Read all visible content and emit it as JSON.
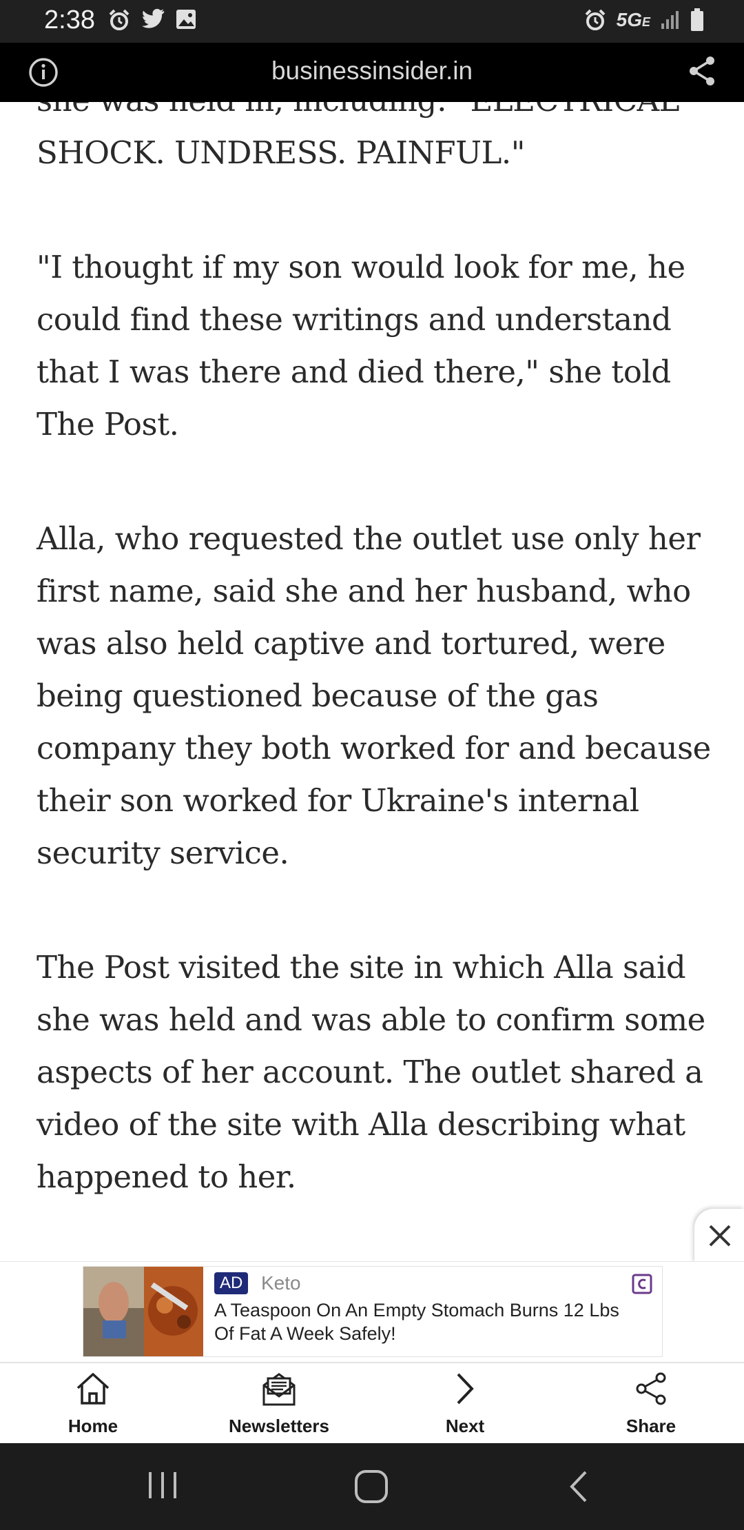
{
  "status_bar": {
    "time": "2:38",
    "network": "5G",
    "network_sub": "E",
    "left_icons": [
      "alarm-icon",
      "twitter-icon",
      "image-icon"
    ],
    "right_icons": [
      "alarm-icon",
      "signal-icon",
      "battery-icon"
    ]
  },
  "url_bar": {
    "domain": "businessinsider.in"
  },
  "article": {
    "paragraphs": [
      "she was held in, including: \"ELECTRICAL SHOCK. UNDRESS. PAINFUL.\"",
      "\"I thought if my son would look for me, he could find these writings and understand that I was there and died there,\" she told The Post.",
      "Alla, who requested the outlet use only her first name, said she and her husband, who was also held captive and tortured, were being questioned because of the gas company they both worked for and because their son worked for Ukraine's internal security service.",
      "The Post visited the site in which Alla said she was held and was able to confirm some aspects of her account. The outlet shared a video of the site with Alla describing what happened to her."
    ]
  },
  "ad": {
    "badge": "AD",
    "brand": "Keto",
    "headline": "A Teaspoon On An Empty Stomach Burns 12 Lbs Of Fat A Week Safely!"
  },
  "bottom_nav": {
    "items": [
      {
        "label": "Home",
        "icon": "home-icon"
      },
      {
        "label": "Newsletters",
        "icon": "newsletter-icon"
      },
      {
        "label": "Next",
        "icon": "chevron-right-icon"
      },
      {
        "label": "Share",
        "icon": "share-icon"
      }
    ]
  },
  "colors": {
    "status_bar": "#202020",
    "url_bar": "#000000",
    "ad_badge": "#1f2a78",
    "system_nav": "#1c1c1c"
  }
}
